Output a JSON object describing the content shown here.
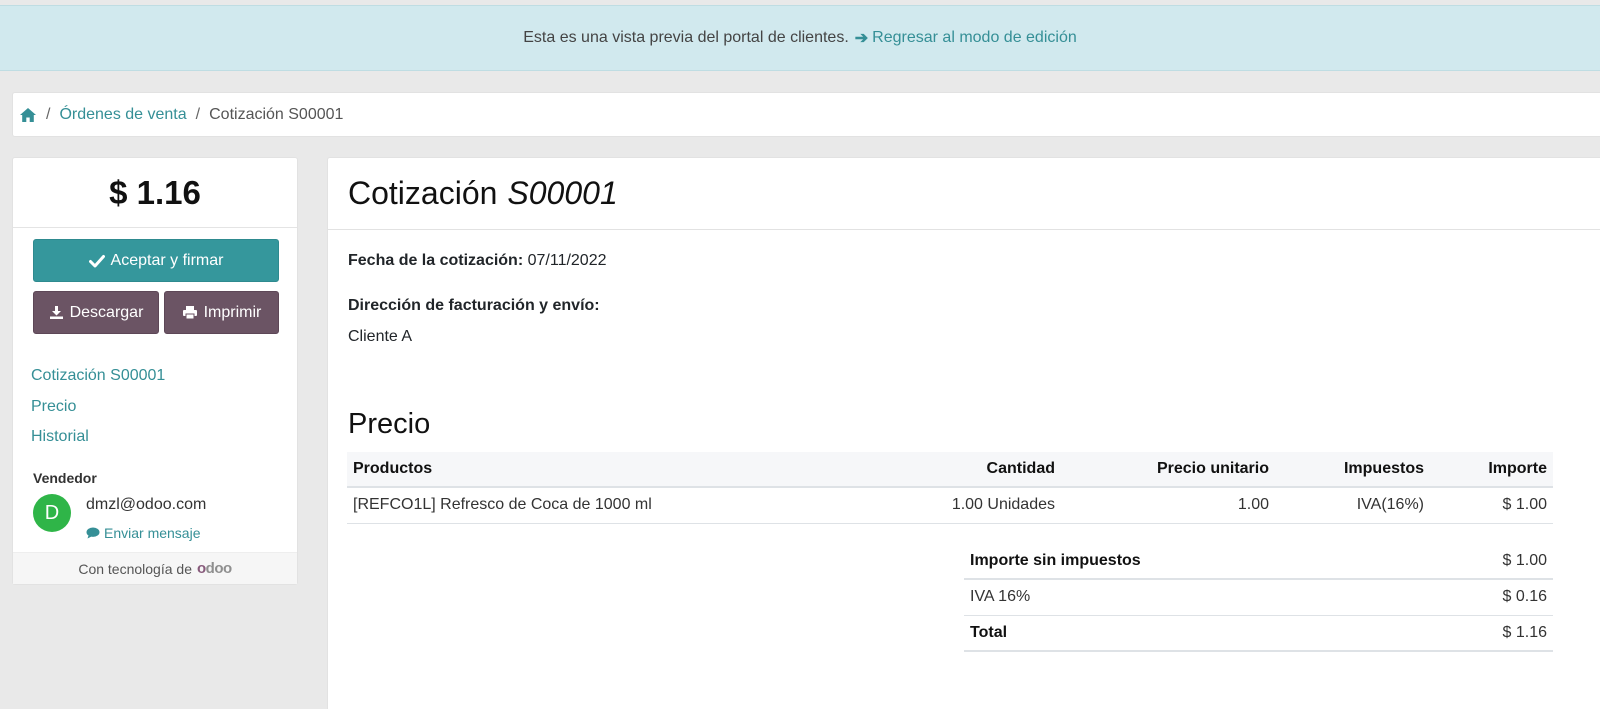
{
  "banner": {
    "text": "Esta es una vista previa del portal de clientes.",
    "link": "Regresar al modo de edición"
  },
  "breadcrumb": {
    "home_icon": "home-icon",
    "items": [
      "Órdenes de venta",
      "Cotización S00001"
    ]
  },
  "sidebar": {
    "total": "$ 1.16",
    "accept_label": "Aceptar y firmar",
    "download_label": "Descargar",
    "print_label": "Imprimir",
    "links": [
      "Cotización S00001",
      "Precio",
      "Historial"
    ],
    "seller_label": "Vendedor",
    "seller_initial": "D",
    "seller_email": "dmzl@odoo.com",
    "send_message": "Enviar mensaje",
    "powered_by": "Con tecnología de",
    "logo": "odoo"
  },
  "document": {
    "title": "Cotización",
    "reference": "S00001",
    "date_label": "Fecha de la cotización:",
    "date_value": "07/11/2022",
    "address_label": "Dirección de facturación y envío:",
    "address_value": "Cliente A",
    "section_title": "Precio"
  },
  "lines_table": {
    "headers": [
      "Productos",
      "Cantidad",
      "Precio unitario",
      "Impuestos",
      "Importe"
    ],
    "rows": [
      [
        "[REFCO1L] Refresco de Coca de 1000 ml",
        "1.00 Unidades",
        "1.00",
        "IVA(16%)",
        "$ 1.00"
      ]
    ]
  },
  "totals": [
    {
      "label": "Importe sin impuestos",
      "value": "$ 1.00"
    },
    {
      "label": "IVA 16%",
      "value": "$ 0.16"
    },
    {
      "label": "Total",
      "value": "$ 1.16"
    }
  ],
  "colors": {
    "accent": "#358f96",
    "accept_button": "#35979c",
    "secondary_button": "#6b5464",
    "banner_bg": "#d1e9ee",
    "avatar": "#2fb548"
  }
}
